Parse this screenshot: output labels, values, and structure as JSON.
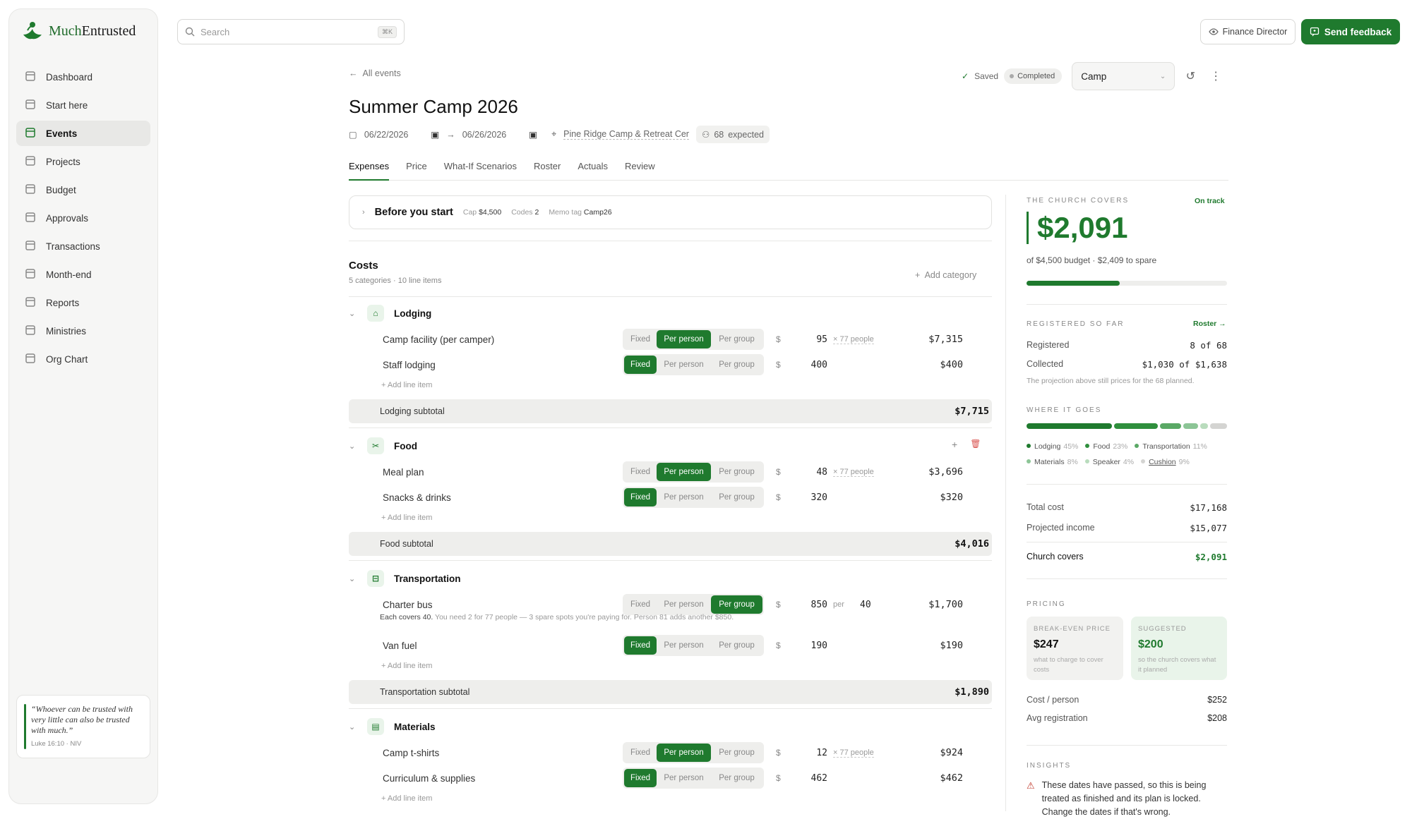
{
  "app": {
    "logo_much": "Much",
    "logo_entrusted": "Entrusted"
  },
  "sidebar": {
    "items": [
      {
        "label": "Dashboard",
        "icon": "dashboard-icon"
      },
      {
        "label": "Start here",
        "icon": "compass-icon"
      },
      {
        "label": "Events",
        "icon": "calendar-icon",
        "active": true
      },
      {
        "label": "Projects",
        "icon": "projects-icon"
      },
      {
        "label": "Budget",
        "icon": "wallet-icon"
      },
      {
        "label": "Approvals",
        "icon": "stamp-icon"
      },
      {
        "label": "Transactions",
        "icon": "receipt-icon"
      },
      {
        "label": "Month-end",
        "icon": "calendar-check-icon"
      },
      {
        "label": "Reports",
        "icon": "trend-icon"
      },
      {
        "label": "Ministries",
        "icon": "church-icon"
      },
      {
        "label": "Org Chart",
        "icon": "org-chart-icon"
      }
    ],
    "quote": {
      "text": "“Whoever can be trusted with very little can also be trusted with much.”",
      "ref": "Luke 16:10 · NIV"
    }
  },
  "topbar": {
    "search_placeholder": "Search",
    "search_kbd": "⌘K",
    "role": "Finance Director",
    "feedback": "Send feedback"
  },
  "header": {
    "back": "All events",
    "saved": "Saved",
    "status": "Completed",
    "type": "Camp",
    "title": "Summer Camp 2026",
    "start_date": "06/22/2026",
    "end_date": "06/26/2026",
    "location": "Pine Ridge Camp & Retreat Center",
    "expected_count": "68",
    "expected_label": "expected"
  },
  "tabs": [
    "Expenses",
    "Price",
    "What-If Scenarios",
    "Roster",
    "Actuals",
    "Review"
  ],
  "before": {
    "title": "Before you start",
    "cap_label": "Cap",
    "cap": "$4,500",
    "codes_label": "Codes",
    "codes": "2",
    "memo_label": "Memo tag",
    "memo": "Camp26"
  },
  "costs": {
    "title": "Costs",
    "sub": "5 categories · 10 line items",
    "add_category": "Add category",
    "add_line": "Add line item"
  },
  "modes": {
    "fixed": "Fixed",
    "per_person": "Per person",
    "per_group": "Per group"
  },
  "categories": [
    {
      "name": "Lodging",
      "subtotal_label": "Lodging subtotal",
      "subtotal": "$7,715",
      "items": [
        {
          "name": "Camp facility (per camper)",
          "mode": "per_person",
          "amount": "95",
          "qty": "× 77 people",
          "total": "$7,315"
        },
        {
          "name": "Staff lodging",
          "mode": "fixed",
          "amount": "400",
          "total": "$400"
        }
      ]
    },
    {
      "name": "Food",
      "subtotal_label": "Food subtotal",
      "subtotal": "$4,016",
      "items": [
        {
          "name": "Meal plan",
          "mode": "per_person",
          "amount": "48",
          "qty": "× 77 people",
          "total": "$3,696"
        },
        {
          "name": "Snacks & drinks",
          "mode": "fixed",
          "amount": "320",
          "total": "$320"
        }
      ]
    },
    {
      "name": "Transportation",
      "subtotal_label": "Transportation subtotal",
      "subtotal": "$1,890",
      "items": [
        {
          "name": "Charter bus",
          "mode": "per_group",
          "amount": "850",
          "per": "per",
          "count": "40",
          "total": "$1,700",
          "note_bold": "Each covers 40.",
          "note": " You need 2 for 77 people — 3 spare spots you're paying for. Person 81 adds another $850."
        },
        {
          "name": "Van fuel",
          "mode": "fixed",
          "amount": "190",
          "total": "$190"
        }
      ]
    },
    {
      "name": "Materials",
      "items": [
        {
          "name": "Camp t-shirts",
          "mode": "per_person",
          "amount": "12",
          "qty": "× 77 people",
          "total": "$924"
        },
        {
          "name": "Curriculum & supplies",
          "mode": "fixed",
          "amount": "462",
          "total": "$462"
        }
      ]
    }
  ],
  "currency": "$",
  "summary": {
    "covers_label": "THE CHURCH COVERS",
    "on_track": "On track",
    "amount": "$2,091",
    "budget_line": "of $4,500 budget · $2,409 to spare",
    "progress_fraction": 0.465,
    "registered_label": "REGISTERED SO FAR",
    "roster_link": "Roster →",
    "registered": "Registered",
    "registered_value": "8 of 68",
    "collected": "Collected",
    "collected_value": "$1,030 of $1,638",
    "projection_note": "The projection above still prices for the 68 planned.",
    "where_label": "WHERE IT GOES",
    "where": [
      {
        "name": "Lodging",
        "pct": "45%",
        "value": 45,
        "color": "#1f7a2e"
      },
      {
        "name": "Food",
        "pct": "23%",
        "value": 23,
        "color": "#2f8f3d"
      },
      {
        "name": "Transportation",
        "pct": "11%",
        "value": 11,
        "color": "#5aa865"
      },
      {
        "name": "Materials",
        "pct": "8%",
        "value": 8,
        "color": "#8cc596"
      },
      {
        "name": "Speaker",
        "pct": "4%",
        "value": 4,
        "color": "#b9dcbd"
      },
      {
        "name": "Cushion",
        "pct": "9%",
        "value": 9,
        "color": "#d4d4d2"
      }
    ],
    "total_cost": "Total cost",
    "total_cost_value": "$17,168",
    "projected_income": "Projected income",
    "projected_income_value": "$15,077",
    "church_covers": "Church covers",
    "church_covers_value": "$2,091",
    "pricing_label": "PRICING",
    "breakeven_label": "BREAK-EVEN PRICE",
    "breakeven": "$247",
    "breakeven_note": "what to charge to cover costs",
    "suggested_label": "SUGGESTED",
    "suggested": "$200",
    "suggested_note": "so the church covers what it planned",
    "cost_person": "Cost / person",
    "cost_person_value": "$252",
    "avg_reg": "Avg registration",
    "avg_reg_value": "$208",
    "insights_label": "INSIGHTS",
    "insight": "These dates have passed, so this is being treated as finished and its plan is locked. Change the dates if that's wrong."
  }
}
